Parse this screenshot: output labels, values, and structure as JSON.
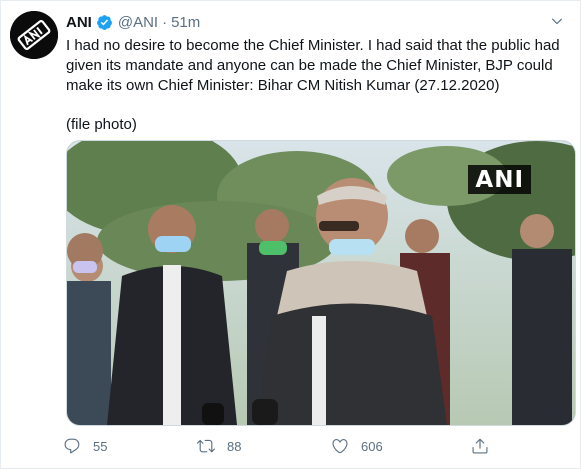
{
  "tweet": {
    "name": "ANI",
    "handle": "@ANI",
    "separator": "·",
    "time": "51m",
    "text": "I had no desire to become the Chief Minister. I had said that the public had given its mandate and anyone can be made the Chief Minister, BJP could make its own Chief Minister: Bihar CM Nitish Kumar (27.12.2020)",
    "note": "(file photo)",
    "media_watermark": "ANI",
    "avatar_logo": "ANI"
  },
  "actions": {
    "reply_count": "55",
    "retweet_count": "88",
    "like_count": "606"
  },
  "icons": {
    "verified": "verified-badge-icon",
    "caret": "chevron-down-icon",
    "reply": "reply-icon",
    "retweet": "retweet-icon",
    "like": "heart-icon",
    "share": "share-icon"
  },
  "colors": {
    "text": "#0f1419",
    "secondary": "#5b7083",
    "verified": "#1da1f2"
  }
}
